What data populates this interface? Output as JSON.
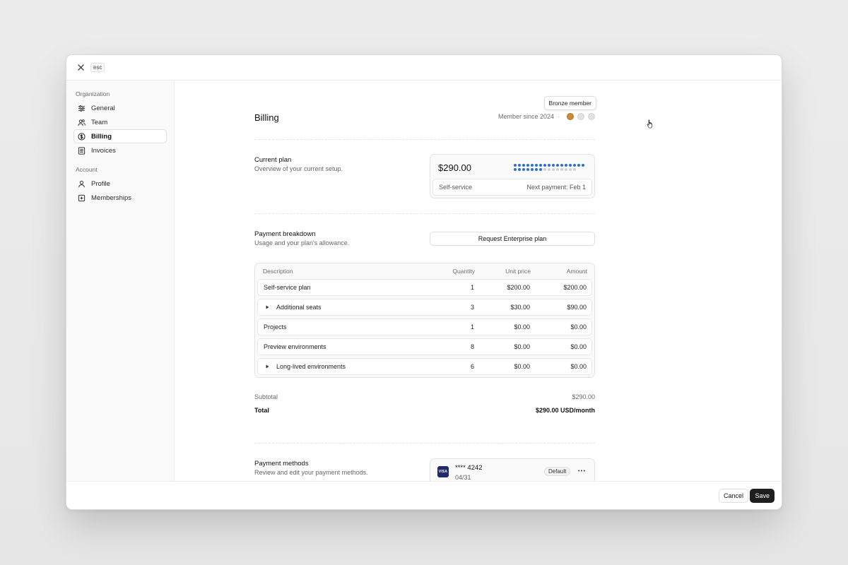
{
  "topbar": {
    "esc_label": "esc"
  },
  "sidebar": {
    "groups": [
      {
        "title": "Organization",
        "items": [
          {
            "label": "General",
            "icon": "sliders-icon"
          },
          {
            "label": "Team",
            "icon": "users-icon"
          },
          {
            "label": "Billing",
            "icon": "dollar-circle-icon",
            "active": true
          },
          {
            "label": "Invoices",
            "icon": "receipt-icon"
          }
        ]
      },
      {
        "title": "Account",
        "items": [
          {
            "label": "Profile",
            "icon": "user-icon"
          },
          {
            "label": "Memberships",
            "icon": "badge-plus-icon"
          }
        ]
      }
    ]
  },
  "header": {
    "title": "Billing",
    "member_since": "Member since 2024",
    "separator": "·",
    "tooltip": "Bronze member",
    "tier_colors": {
      "bronze": "#c98a3d",
      "inactive": "#e2e2e2"
    }
  },
  "current_plan": {
    "title": "Current plan",
    "subtitle": "Overview of your current setup.",
    "price": "$290.00",
    "usage_total": 32,
    "usage_used": 24,
    "usage_colors": {
      "used": "#2d6fd6",
      "unused": "#d3d3d3"
    },
    "plan_name": "Self-service",
    "next_payment": "Next payment: Feb 1"
  },
  "payment_breakdown": {
    "title": "Payment breakdown",
    "subtitle": "Usage and your plan's allowance.",
    "enterprise_button": "Request Enterprise plan",
    "columns": {
      "description": "Description",
      "quantity": "Quantity",
      "unit_price": "Unit price",
      "amount": "Amount"
    },
    "rows": [
      {
        "description": "Self-service plan",
        "quantity": "1",
        "unit_price": "$200.00",
        "amount": "$200.00"
      },
      {
        "description": "Additional seats",
        "quantity": "3",
        "unit_price": "$30.00",
        "amount": "$90.00"
      },
      {
        "description": "Projects",
        "quantity": "1",
        "unit_price": "$0.00",
        "amount": "$0.00"
      },
      {
        "description": "Preview environments",
        "quantity": "8",
        "unit_price": "$0.00",
        "amount": "$0.00"
      },
      {
        "description": "Long-lived environments",
        "quantity": "6",
        "unit_price": "$0.00",
        "amount": "$0.00"
      }
    ],
    "subtotal_label": "Subtotal",
    "subtotal_value": "$290.00",
    "total_label": "Total",
    "total_value": "$290.00 USD/month"
  },
  "payment_methods": {
    "title": "Payment methods",
    "subtitle": "Review and edit your payment methods.",
    "card_brand": "VISA",
    "card_number": "**** 4242",
    "card_expiry": "04/31",
    "default_badge": "Default"
  },
  "footer": {
    "cancel_label": "Cancel",
    "save_label": "Save"
  }
}
